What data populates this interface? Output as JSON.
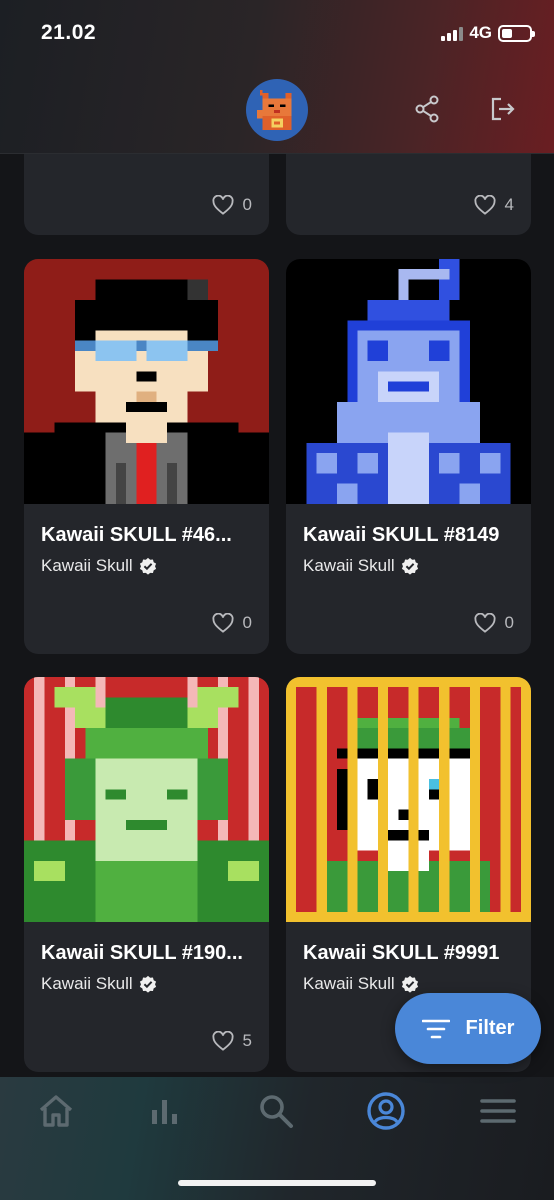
{
  "status_bar": {
    "time": "21.02",
    "network": "4G"
  },
  "header": {
    "avatar_icon": "lucky-cat-avatar",
    "share_icon": "share-icon",
    "logout_icon": "logout-icon"
  },
  "cards": [
    {
      "likes": "0"
    },
    {
      "likes": "4"
    },
    {
      "title": "Kawaii SKULL #46...",
      "collection": "Kawaii Skull",
      "likes": "0"
    },
    {
      "title": "Kawaii SKULL #8149",
      "collection": "Kawaii Skull",
      "likes": "0"
    },
    {
      "title": "Kawaii SKULL #190...",
      "collection": "Kawaii Skull",
      "likes": "5"
    },
    {
      "title": "Kawaii SKULL #9991",
      "collection": "Kawaii Skull"
    }
  ],
  "filter": {
    "label": "Filter"
  },
  "bottom_nav": {
    "items": [
      "home-icon",
      "stats-icon",
      "search-icon",
      "profile-icon",
      "menu-icon"
    ],
    "active": "profile-icon",
    "active_color": "#4a87d8",
    "inactive_color": "#5d6a70"
  },
  "colors": {
    "accent": "#4a87d8",
    "card_bg": "#24262b",
    "page_bg": "#141518"
  }
}
